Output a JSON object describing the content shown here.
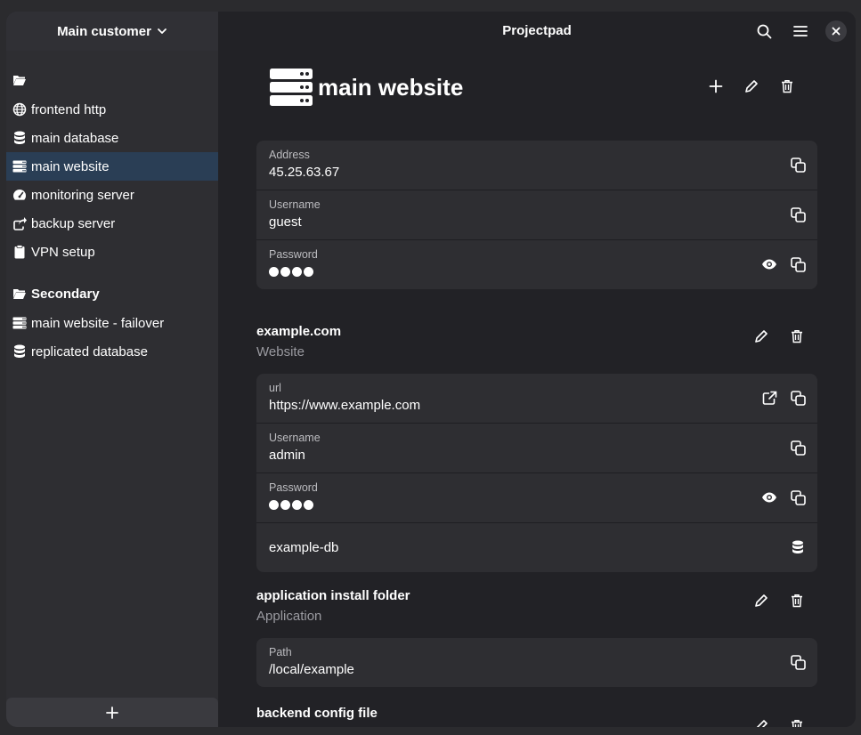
{
  "sidebar": {
    "project": "Main customer",
    "groups": [
      {
        "label": "",
        "items": [
          {
            "label": "frontend http",
            "icon": "globe-icon"
          },
          {
            "label": "main database",
            "icon": "database-icon"
          },
          {
            "label": "main website",
            "icon": "server-icon",
            "active": true
          },
          {
            "label": "monitoring server",
            "icon": "gauge-icon"
          },
          {
            "label": "backup server",
            "icon": "share-icon"
          },
          {
            "label": "VPN setup",
            "icon": "clipboard-icon"
          }
        ]
      },
      {
        "label": "Secondary",
        "items": [
          {
            "label": "main website - failover",
            "icon": "server-icon"
          },
          {
            "label": "replicated database",
            "icon": "database-icon"
          }
        ]
      }
    ]
  },
  "app": {
    "title": "Projectpad"
  },
  "server": {
    "title": "main website",
    "fields": [
      {
        "label": "Address",
        "value": "45.25.63.67"
      },
      {
        "label": "Username",
        "value": "guest"
      },
      {
        "label": "Password",
        "value": ""
      }
    ]
  },
  "sections": [
    {
      "title": "example.com",
      "subtitle": "Website",
      "fields": [
        {
          "label": "url",
          "value": "https://www.example.com"
        },
        {
          "label": "Username",
          "value": "admin"
        },
        {
          "label": "Password",
          "value": ""
        },
        {
          "label": "",
          "value": "example-db"
        }
      ]
    },
    {
      "title": "application install folder",
      "subtitle": "Application",
      "fields": [
        {
          "label": "Path",
          "value": "/local/example"
        }
      ]
    },
    {
      "title": "backend config file",
      "subtitle": ""
    }
  ],
  "colors": {
    "accent_selected": "#2a3e55",
    "card_bg": "#2e2e32",
    "window_bg": "#222226"
  }
}
